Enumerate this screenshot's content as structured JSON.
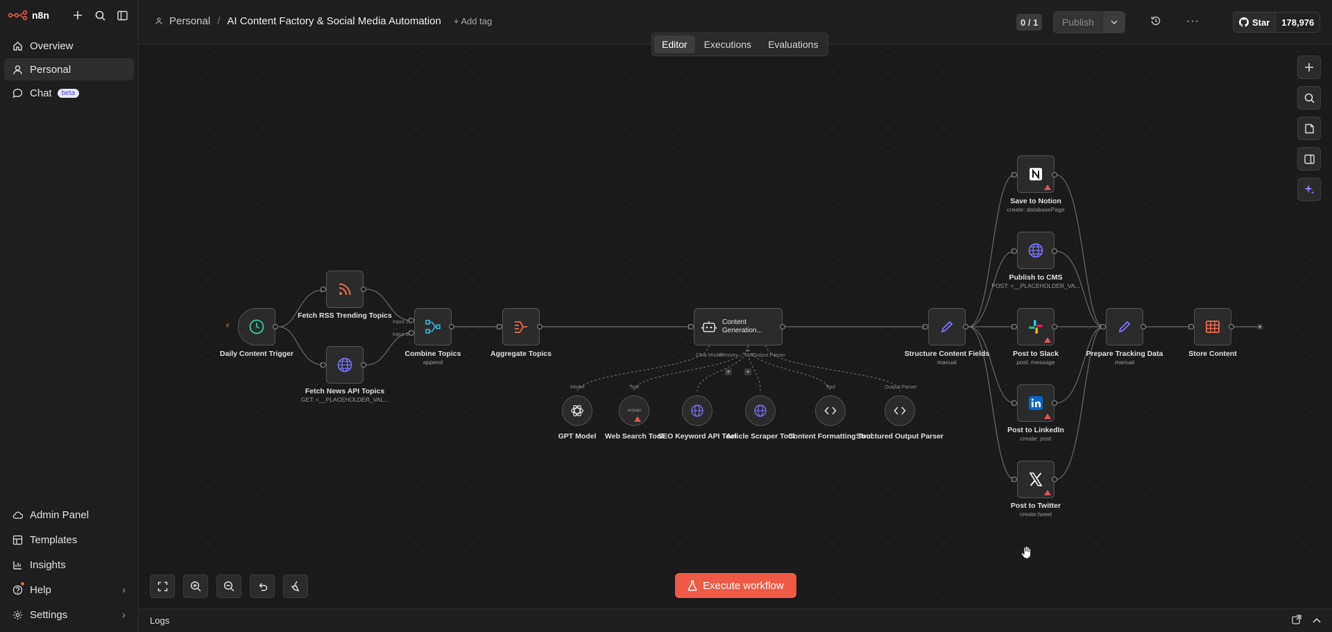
{
  "app": {
    "name": "n8n"
  },
  "sidebar": {
    "items": [
      {
        "label": "Overview"
      },
      {
        "label": "Personal"
      },
      {
        "label": "Chat",
        "badge": "beta"
      }
    ],
    "bottom": [
      {
        "label": "Admin Panel"
      },
      {
        "label": "Templates"
      },
      {
        "label": "Insights"
      },
      {
        "label": "Help"
      },
      {
        "label": "Settings"
      }
    ]
  },
  "header": {
    "project": "Personal",
    "workflow_name": "AI Content Factory & Social Media Automation",
    "add_tag": "+ Add tag",
    "counter": "0 / 1",
    "publish_label": "Publish",
    "github_star": "Star",
    "github_count": "178,976"
  },
  "tabs": [
    "Editor",
    "Executions",
    "Evaluations"
  ],
  "nodes": {
    "daily_trigger": {
      "label": "Daily Content Trigger"
    },
    "fetch_rss": {
      "label": "Fetch RSS Trending Topics"
    },
    "fetch_news": {
      "label": "Fetch News API Topics",
      "sub": "GET: <__PLACEHOLDER_VAL..."
    },
    "combine": {
      "label": "Combine Topics",
      "sub": "append",
      "in1": "Input 1",
      "in2": "Input 2"
    },
    "aggregate": {
      "label": "Aggregate Topics"
    },
    "content_gen": {
      "title": "Content Generation...",
      "h1": "Chat Model",
      "h2": "Memory",
      "h3": "Tool",
      "h4": "Output Parser"
    },
    "gpt": {
      "label": "GPT Model",
      "type": "Model"
    },
    "web_search": {
      "label": "Web Search Tool",
      "type": "Tool",
      "icon_text": "serpapi"
    },
    "seo": {
      "label": "SEO Keyword API Tool"
    },
    "scraper": {
      "label": "Article Scraper Tool"
    },
    "formatting": {
      "label": "Content Formatting Tool",
      "type": "Tool"
    },
    "parser": {
      "label": "Structured Output Parser",
      "type": "Output Parser"
    },
    "structure": {
      "label": "Structure Content Fields",
      "sub": "manual"
    },
    "notion": {
      "label": "Save to Notion",
      "sub": "create: databasePage"
    },
    "cms": {
      "label": "Publish to CMS",
      "sub": "POST: <__PLACEHOLDER_VA..."
    },
    "slack": {
      "label": "Post to Slack",
      "sub": "post: message"
    },
    "linkedin": {
      "label": "Post to LinkedIn",
      "sub": "create: post"
    },
    "twitter": {
      "label": "Post to Twitter",
      "sub": "create:tweet"
    },
    "tracking": {
      "label": "Prepare Tracking Data",
      "sub": "manual"
    },
    "store": {
      "label": "Store Content"
    }
  },
  "execute_label": "Execute workflow",
  "logs_label": "Logs",
  "colors": {
    "accent": "#ef5a46",
    "trigger_green": "#3ec9a6",
    "rss_orange": "#f26b4f",
    "globe_purple": "#7b77ff",
    "combine_teal": "#3fb4e0",
    "edit_blue": "#7b77ff"
  }
}
